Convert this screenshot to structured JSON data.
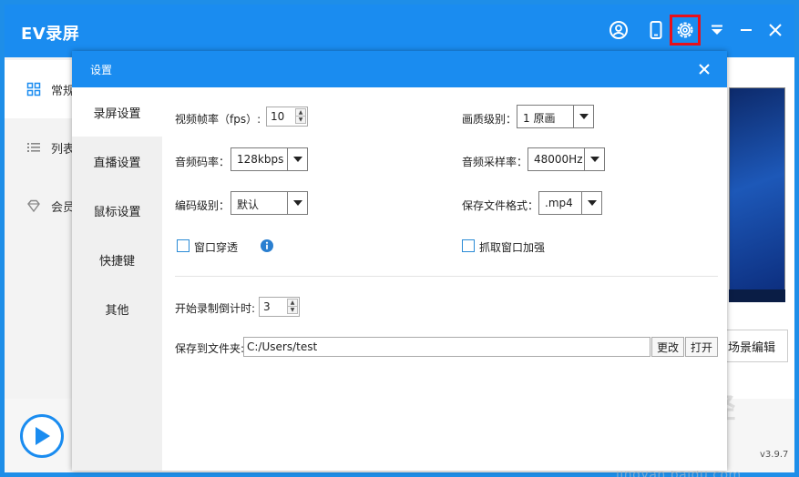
{
  "app": {
    "title": "EV录屏",
    "version": "v3.9.7",
    "accent_color": "#1a8cf0"
  },
  "titlebar": {
    "icons": [
      "user-circle-icon",
      "mobile-icon",
      "settings-gear-icon",
      "menu-dropdown-icon",
      "minimize-icon",
      "close-icon"
    ],
    "highlighted_icon": "settings-gear-icon",
    "highlight_color": "#e8101a"
  },
  "main_sidebar": {
    "items": [
      {
        "label": "常规",
        "icon": "grid-icon"
      },
      {
        "label": "列表",
        "icon": "list-icon"
      },
      {
        "label": "会员",
        "icon": "diamond-icon"
      }
    ]
  },
  "main_right": {
    "scene_button_label": "场景编辑"
  },
  "watermark": {
    "line1": "Baidu经验",
    "line2": "jingyan.baidu.com"
  },
  "dialog": {
    "title": "设置",
    "nav": [
      {
        "label": "录屏设置",
        "active": true
      },
      {
        "label": "直播设置",
        "active": false
      },
      {
        "label": "鼠标设置",
        "active": false
      },
      {
        "label": "快捷键",
        "active": false
      },
      {
        "label": "其他",
        "active": false
      }
    ],
    "fps": {
      "label": "视频帧率（fps）:",
      "value": "10"
    },
    "quality": {
      "label": "画质级别：",
      "value": "1 原画"
    },
    "audio_bitrate": {
      "label": "音频码率：",
      "value": "128kbps"
    },
    "sample_rate": {
      "label": "音频采样率：",
      "value": "48000Hz"
    },
    "encode_level": {
      "label": "编码级别：",
      "value": "默认"
    },
    "file_format": {
      "label": "保存文件格式：",
      "value": ".mp4"
    },
    "window_through": {
      "label": "窗口穿透",
      "checked": false
    },
    "capture_enhance": {
      "label": "抓取窗口加强",
      "checked": false
    },
    "countdown": {
      "label": "开始录制倒计时:",
      "value": "3"
    },
    "save_folder": {
      "label": "保存到文件夹:",
      "value": "C:/Users/test",
      "change_label": "更改",
      "open_label": "打开"
    }
  }
}
